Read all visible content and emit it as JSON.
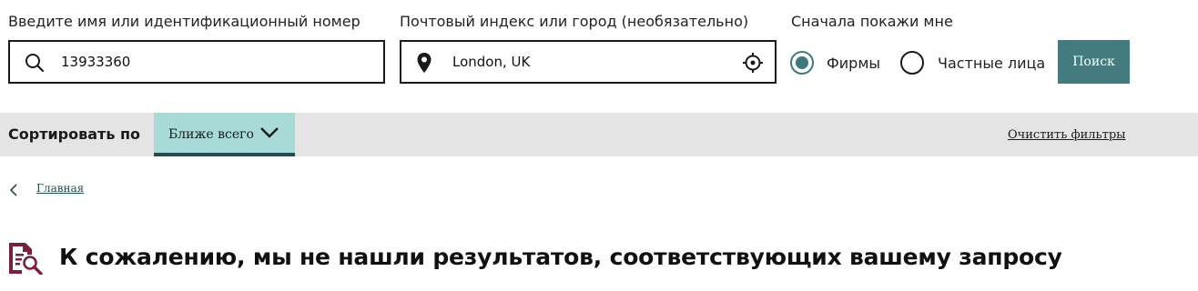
{
  "search": {
    "name_label": "Введите имя или идентификационный номер",
    "name_value": "13933360",
    "location_label": "Почтовый индекс или город (необязательно)",
    "location_value": "London, UK",
    "show_first_label": "Сначала покажи мне",
    "options": [
      {
        "label": "Фирмы",
        "checked": true
      },
      {
        "label": "Частные лица",
        "checked": false
      }
    ],
    "button_label": "Поиск"
  },
  "sort": {
    "label": "Сортировать по",
    "selected": "Ближе всего",
    "clear_filters": "Очистить фильтры"
  },
  "breadcrumb": {
    "home": "Главная"
  },
  "results": {
    "message": "К сожалению, мы не нашли результатов, соответствующих вашему запросу"
  },
  "colors": {
    "accent": "#437b7e",
    "sort_bg": "#a8dbd8",
    "sort_underline": "#1f4d51",
    "bar_bg": "#e4e4e4",
    "icon_maroon": "#7a1f3d"
  },
  "icons": {
    "search": "search-icon",
    "location": "map-pin-icon",
    "locate": "crosshair-icon",
    "sort": "chevron-down-icon",
    "back": "chevron-left-icon",
    "no_results": "document-search-icon"
  }
}
